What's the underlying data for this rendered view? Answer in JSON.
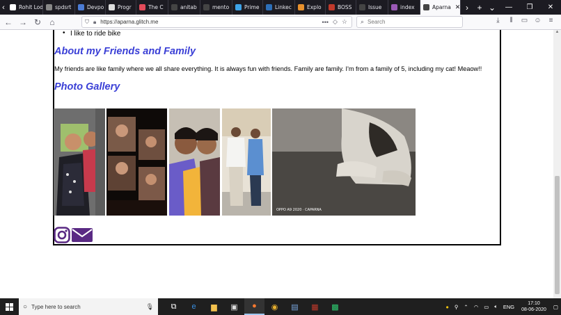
{
  "browser": {
    "tabs": [
      {
        "label": "Rohit Lodi",
        "color": "#ffffff"
      },
      {
        "label": "spdsrt",
        "color": "#888888"
      },
      {
        "label": "Devpo",
        "color": "#4b7bd4"
      },
      {
        "label": "Progr",
        "color": "#dddddd"
      },
      {
        "label": "The C",
        "color": "#e34b5a"
      },
      {
        "label": "anitab",
        "color": "#444444"
      },
      {
        "label": "mento",
        "color": "#444444"
      },
      {
        "label": "Prime",
        "color": "#3da3e8"
      },
      {
        "label": "Linkec",
        "color": "#2d6fb8"
      },
      {
        "label": "Explo",
        "color": "#e8912d"
      },
      {
        "label": "BOSS",
        "color": "#c0392b"
      },
      {
        "label": "Issue",
        "color": "#444444"
      },
      {
        "label": "index",
        "color": "#9b59b6"
      },
      {
        "label": "Aparna",
        "color": "#444444",
        "active": true
      }
    ],
    "url": "https://aparna.glitch.me",
    "search_placeholder": "Search"
  },
  "page": {
    "hobby_item": "I like to ride bike",
    "friends_heading": "About my Friends and Family",
    "friends_text": "My friends are like family where we all share everything. It is always fun with friends. Family are family. I'm from a family of 5, including my cat! Meaow!!",
    "gallery_heading": "Photo Gallery",
    "photo_caption": "OPPO A9 2020 · CAPARNA",
    "social_color": "#5a2a84"
  },
  "taskbar": {
    "search_placeholder": "Type here to search",
    "language": "ENG",
    "time": "17:10",
    "date": "08-06-2020"
  }
}
